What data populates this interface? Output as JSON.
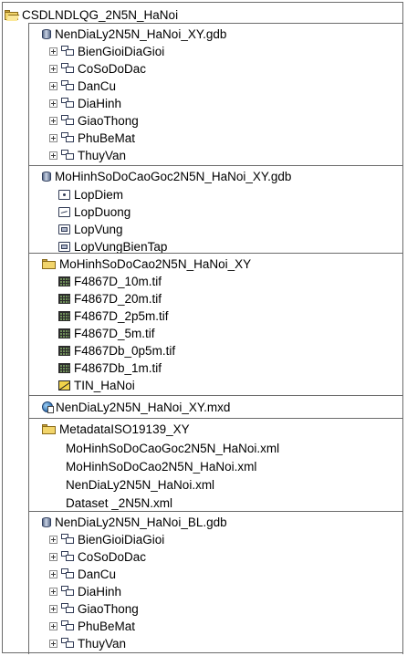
{
  "root": {
    "label": "CSDLNDLQG_2N5N_HaNoi",
    "icon": "open-folder-icon"
  },
  "sections": [
    {
      "header": "NenDiaLy2N5N_HaNoi_XY.gdb",
      "header_icon": "geodatabase-icon",
      "items": [
        {
          "label": "BienGioiDiaGioi",
          "icon": "feature-dataset-icon"
        },
        {
          "label": "CoSoDoDac",
          "icon": "feature-dataset-icon"
        },
        {
          "label": "DanCu",
          "icon": "feature-dataset-icon"
        },
        {
          "label": "DiaHinh",
          "icon": "feature-dataset-icon"
        },
        {
          "label": "GiaoThong",
          "icon": "feature-dataset-icon"
        },
        {
          "label": "PhuBeMat",
          "icon": "feature-dataset-icon"
        },
        {
          "label": "ThuyVan",
          "icon": "feature-dataset-icon"
        }
      ]
    },
    {
      "header": "MoHinhSoDoCaoGoc2N5N_HaNoi_XY.gdb",
      "header_icon": "geodatabase-icon",
      "items": [
        {
          "label": "LopDiem",
          "icon": "point-feature-class-icon"
        },
        {
          "label": "LopDuong",
          "icon": "line-feature-class-icon"
        },
        {
          "label": "LopVung",
          "icon": "polygon-feature-class-icon"
        },
        {
          "label": "LopVungBienTap",
          "icon": "polygon-feature-class-icon"
        }
      ]
    },
    {
      "header": "MoHinhSoDoCao2N5N_HaNoi_XY",
      "header_icon": "folder-icon",
      "items": [
        {
          "label": "F4867D_10m.tif",
          "icon": "raster-icon"
        },
        {
          "label": "F4867D_20m.tif",
          "icon": "raster-icon"
        },
        {
          "label": "F4867D_2p5m.tif",
          "icon": "raster-icon"
        },
        {
          "label": "F4867D_5m.tif",
          "icon": "raster-icon"
        },
        {
          "label": "F4867Db_0p5m.tif",
          "icon": "raster-icon"
        },
        {
          "label": "F4867Db_1m.tif",
          "icon": "raster-icon"
        },
        {
          "label": "TIN_HaNoi",
          "icon": "tin-icon"
        }
      ]
    },
    {
      "header": "NenDiaLy2N5N_HaNoi_XY.mxd",
      "header_icon": "map-document-icon",
      "items": []
    },
    {
      "header": "MetadataISO19139_XY",
      "header_icon": "folder-icon",
      "items": [
        {
          "label": "MoHinhSoDoCaoGoc2N5N_HaNoi.xml"
        },
        {
          "label": "MoHinhSoDoCao2N5N_HaNoi.xml"
        },
        {
          "label": "NenDiaLy2N5N_HaNoi.xml"
        },
        {
          "label": "Dataset _2N5N.xml"
        }
      ]
    },
    {
      "header": "NenDiaLy2N5N_HaNoi_BL.gdb",
      "header_icon": "geodatabase-icon",
      "items": [
        {
          "label": "BienGioiDiaGioi",
          "icon": "feature-dataset-icon"
        },
        {
          "label": "CoSoDoDac",
          "icon": "feature-dataset-icon"
        },
        {
          "label": "DanCu",
          "icon": "feature-dataset-icon"
        },
        {
          "label": "DiaHinh",
          "icon": "feature-dataset-icon"
        },
        {
          "label": "GiaoThong",
          "icon": "feature-dataset-icon"
        },
        {
          "label": "PhuBeMat",
          "icon": "feature-dataset-icon"
        },
        {
          "label": "ThuyVan",
          "icon": "feature-dataset-icon"
        }
      ]
    }
  ]
}
